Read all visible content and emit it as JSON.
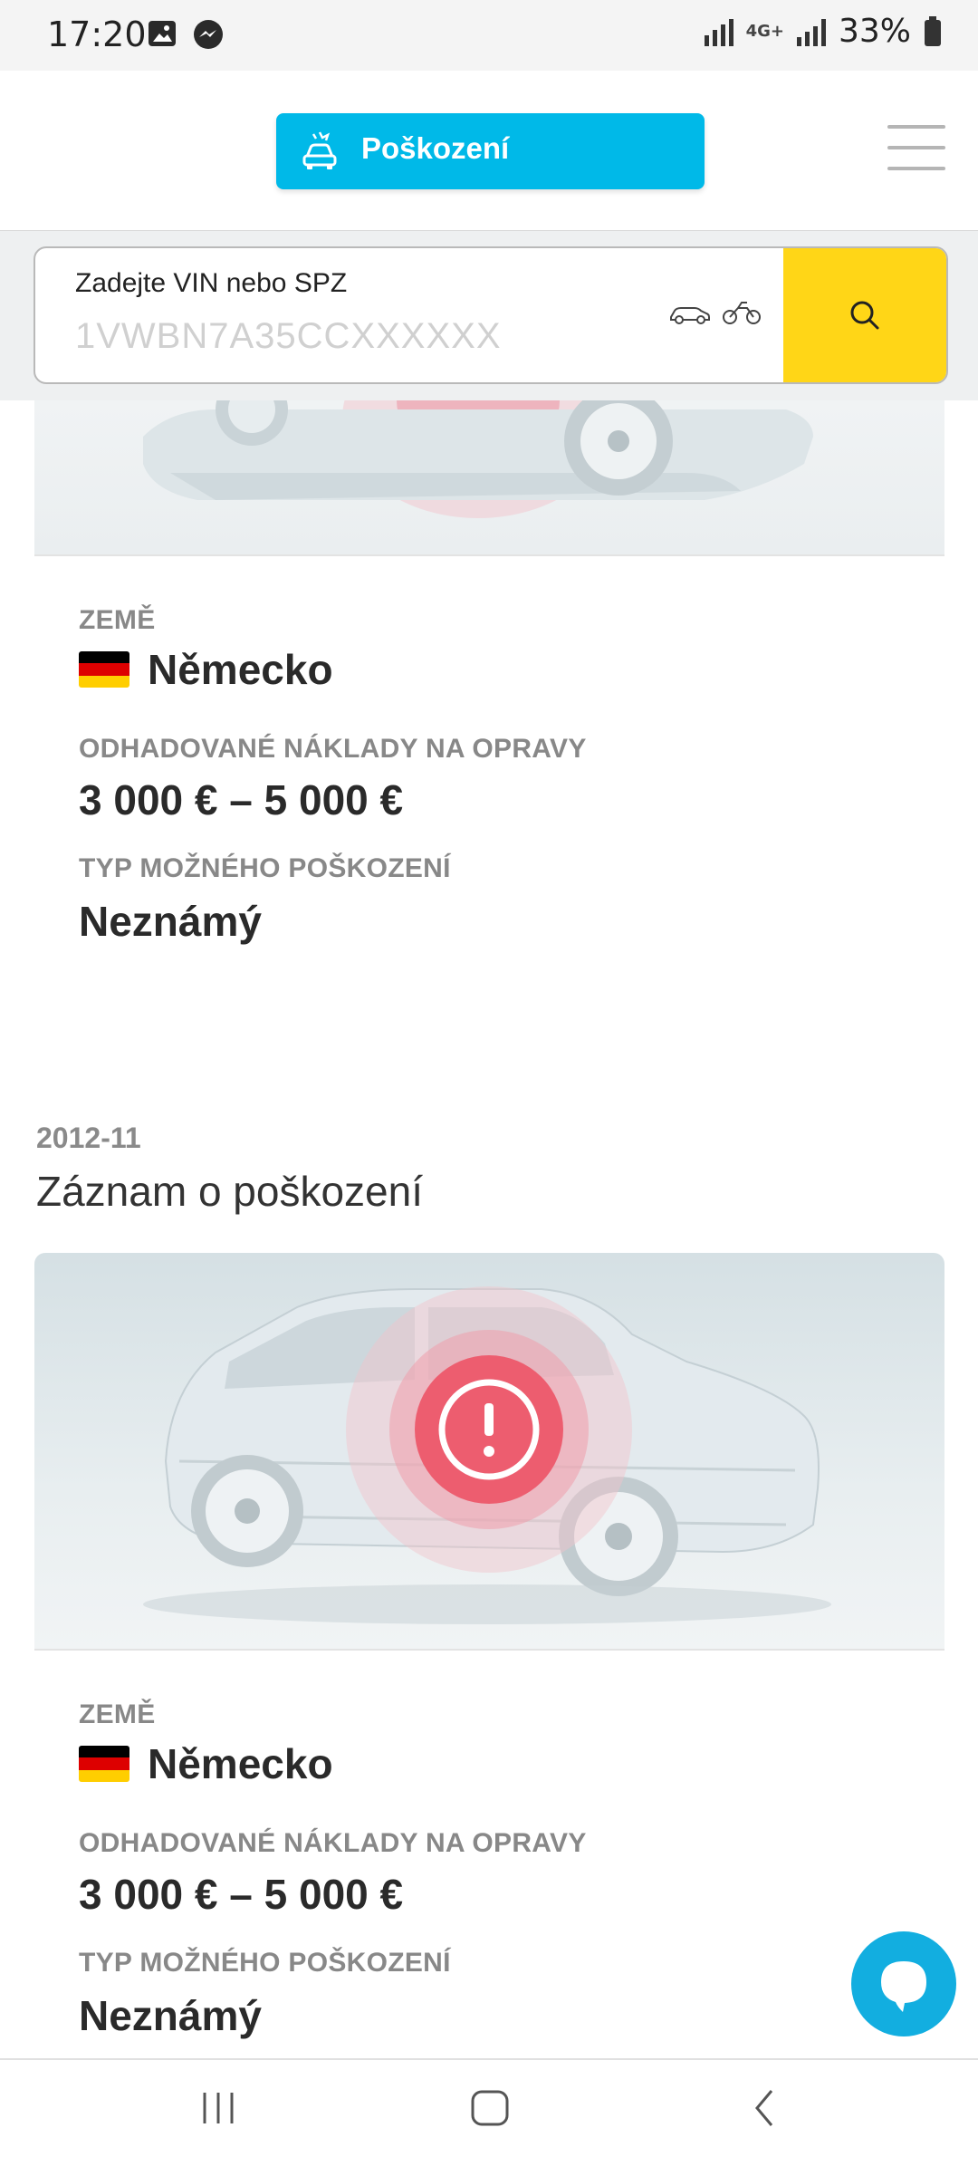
{
  "status_bar": {
    "time": "17:20",
    "battery": "33%",
    "network": "4G+",
    "icons": [
      "gallery-icon",
      "messenger-icon",
      "signal-icon",
      "battery-icon"
    ]
  },
  "header": {
    "nav_label": "Poškození",
    "nav_icon": "car-damage-icon",
    "accent": "#00b9e8"
  },
  "search": {
    "label": "Zadejte VIN nebo SPZ",
    "placeholder": "1VWBN7A35CCXXXXXX",
    "button_color": "#ffd617"
  },
  "records": [
    {
      "country_label": "ZEMĚ",
      "country": "Německo",
      "cost_label": "ODHADOVANÉ NÁKLADY NA OPRAVY",
      "cost": "3 000 € – 5 000 €",
      "type_label": "TYP MOŽNÉHO POŠKOZENÍ",
      "type": "Neznámý"
    },
    {
      "date": "2012-11",
      "title": "Záznam o poškození",
      "country_label": "ZEMĚ",
      "country": "Německo",
      "cost_label": "ODHADOVANÉ NÁKLADY NA OPRAVY",
      "cost": "3 000 € – 5 000 €",
      "type_label": "TYP MOŽNÉHO POŠKOZENÍ",
      "type": "Neznámý"
    }
  ]
}
